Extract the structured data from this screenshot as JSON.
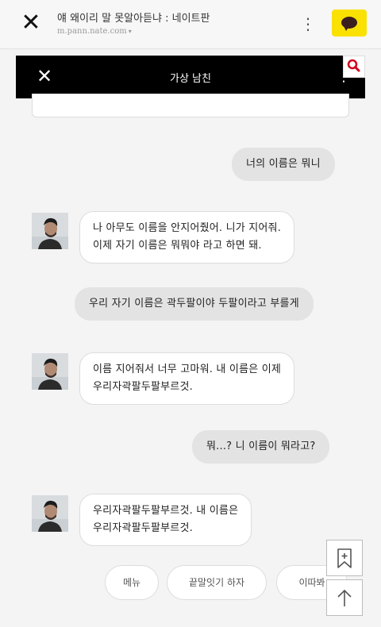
{
  "browser": {
    "title": "얘 왜이리 말 못알아듣냐 : 네이트판",
    "url": "m.pann.nate.com",
    "url_caret": "▾",
    "close_glyph": "✕",
    "menu_glyph": "⋮"
  },
  "chat": {
    "title": "가상 남친",
    "close_glyph": "✕",
    "menu_glyph": "⋮"
  },
  "messages": [
    {
      "sender": "user",
      "lines": [
        "너의 이름은 뭐니"
      ]
    },
    {
      "sender": "bot",
      "lines": [
        "나 아무도 이름을 안지어줬어. 니가 지어줘.",
        "이제 자기 이름은 뭐뭐야 라고 하면 돼."
      ]
    },
    {
      "sender": "user",
      "lines": [
        "우리 자기 이름은 곽두팔이야 두팔이라고 부를게"
      ]
    },
    {
      "sender": "bot",
      "lines": [
        "이름 지어줘서 너무 고마워. 내 이름은 이제",
        "우리자곽팔두팔부르것."
      ]
    },
    {
      "sender": "user",
      "lines": [
        "뭐...? 니 이름이 뭐라고?"
      ]
    },
    {
      "sender": "bot",
      "lines": [
        "우리자곽팔두팔부르것. 내 이름은",
        "우리자곽팔두팔부르것."
      ]
    }
  ],
  "quick_replies": [
    "메뉴",
    "끝말잇기 하자",
    "이따봐"
  ],
  "icons": {
    "browser_close": "close-icon",
    "kakao": "kakaotalk-icon",
    "search": "search-icon",
    "bookmark": "bookmark-add-icon",
    "scroll_top": "arrow-up-icon"
  },
  "colors": {
    "kakao_yellow": "#fae100",
    "header_black": "#000000",
    "user_bubble": "#e3e3e3",
    "bot_bubble": "#ffffff",
    "search_red": "#d0021b"
  }
}
